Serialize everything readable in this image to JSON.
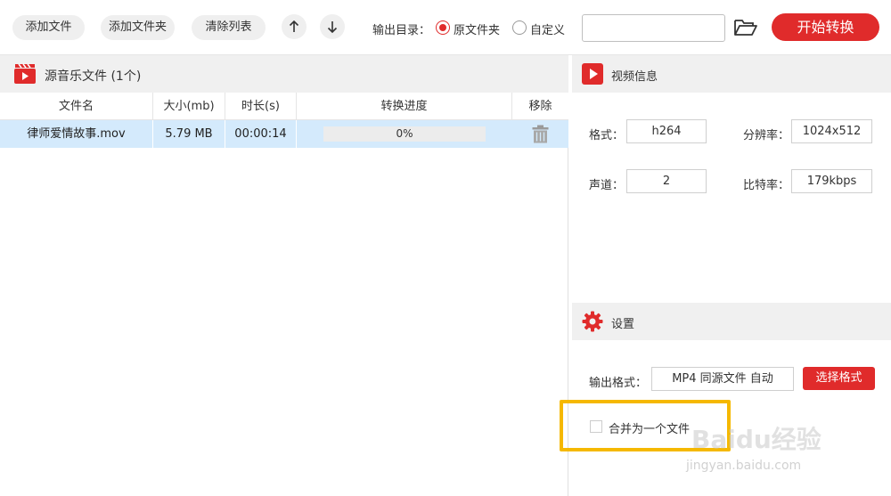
{
  "toolbar": {
    "add_file": "添加文件",
    "add_folder": "添加文件夹",
    "clear_list": "清除列表",
    "output_dir_label": "输出目录：",
    "radio_original": "原文件夹",
    "radio_custom": "自定义",
    "path_value": "",
    "start_button": "开始转换",
    "accent_color": "#e02b2b"
  },
  "file_list": {
    "title": "源音乐文件 (1个)",
    "columns": [
      "文件名",
      "大小(mb)",
      "时长(s)",
      "转换进度",
      "移除"
    ],
    "rows": [
      {
        "name": "律师爱情故事.mov",
        "size": "5.79 MB",
        "duration": "00:00:14",
        "progress_text": "0%",
        "progress_value": 0
      }
    ]
  },
  "video_info": {
    "title": "视频信息",
    "format_label": "格式：",
    "format_value": "h264",
    "resolution_label": "分辨率：",
    "resolution_value": "1024x512",
    "channel_label": "声道：",
    "channel_value": "2",
    "bitrate_label": "比特率：",
    "bitrate_value": "179kbps"
  },
  "settings": {
    "title": "设置",
    "output_format_label": "输出格式：",
    "output_format_value": "MP4 同源文件 自动",
    "select_format_button": "选择格式",
    "merge_label": "合并为一个文件"
  },
  "watermark": {
    "brand": "Baidu经验",
    "url": "jingyan.baidu.com"
  },
  "icons": [
    "arrow-up-icon",
    "arrow-down-icon",
    "folder-open-icon",
    "music-video-icon",
    "trash-icon",
    "play-icon",
    "gear-icon"
  ]
}
